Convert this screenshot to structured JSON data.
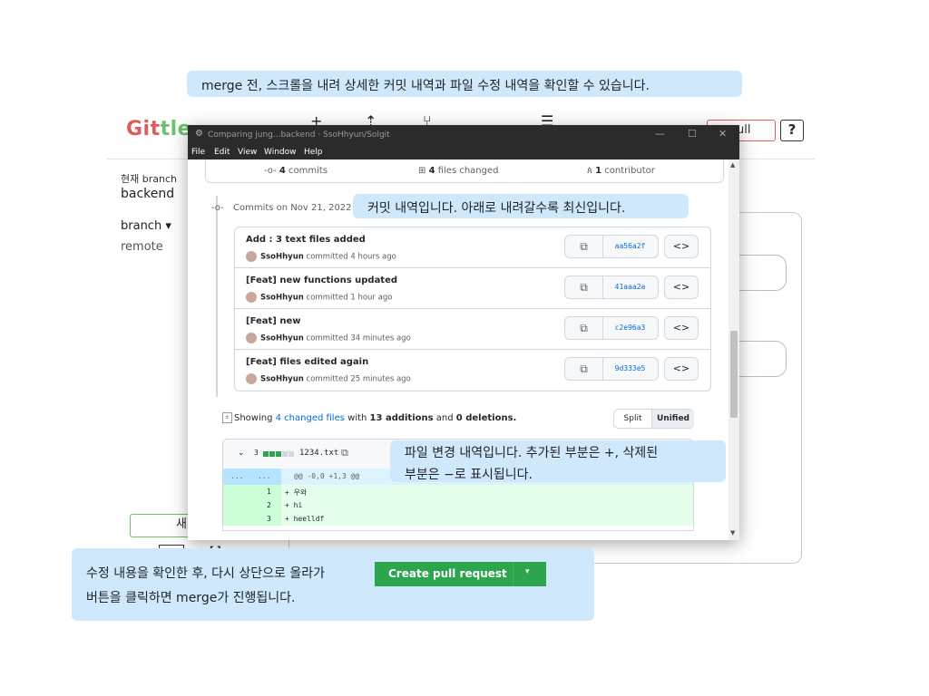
{
  "tips": {
    "top": "merge 전, 스크롤을 내려 상세한 커밋 내역과 파일 수정 내역을 확인할 수 있습니다.",
    "commits": "커밋 내역입니다. 아래로 내려갈수록 최신입니다.",
    "diff_line1": "파일 변경 내역입니다. 추가된 부분은 +, 삭제된",
    "diff_line2": "부분은 −로 표시됩니다.",
    "bottom_line1": "수정 내용을 확인한 후, 다시 상단으로 올라가",
    "bottom_line2": "버튼을 클릭하면 merge가 진행됩니다."
  },
  "app": {
    "logo_part1": "Git",
    "logo_part2": "tle",
    "pull_label": "ull",
    "help_label": "?",
    "current_branch_label": "현재 branch",
    "current_branch": "backend",
    "branch_dropdown": "branch ▾",
    "remote_label": "remote",
    "new_button_fragment": "새",
    "bottom_fragment": "[ ]"
  },
  "window": {
    "title": "Comparing jung...backend · SsoHhyun/Solgit",
    "controls": [
      "—",
      "☐",
      "✕"
    ],
    "menu": [
      "File",
      "Edit",
      "View",
      "Window",
      "Help"
    ]
  },
  "stats": {
    "commits_num": "4",
    "commits_label": "commits",
    "files_num": "4",
    "files_label": "files changed",
    "contrib_num": "1",
    "contrib_label": "contributor"
  },
  "commits_on": "Commits on Nov 21, 2022",
  "commits": [
    {
      "title": "Add : 3 text files added",
      "author": "SsoHhyun",
      "time": "committed 4 hours ago",
      "sha": "aa56a2f"
    },
    {
      "title": "[Feat] new functions updated",
      "author": "SsoHhyun",
      "time": "committed 1 hour ago",
      "sha": "41aaa2a"
    },
    {
      "title": "[Feat] new",
      "author": "SsoHhyun",
      "time": "committed 34 minutes ago",
      "sha": "c2e96a3"
    },
    {
      "title": "[Feat] files edited again",
      "author": "SsoHhyun",
      "time": "committed 25 minutes ago",
      "sha": "9d333e5"
    }
  ],
  "showing": {
    "prefix": "Showing",
    "link": "4 changed files",
    "mid": "with",
    "additions": "13 additions",
    "and": "and",
    "deletions": "0 deletions."
  },
  "view_toggle": {
    "split": "Split",
    "unified": "Unified"
  },
  "file": {
    "count": "3",
    "name": "1234.txt",
    "hunk_left": "...",
    "hunk_right": "...",
    "hunk_header": "@@ -0,0 +1,3 @@",
    "lines": [
      {
        "num": "1",
        "code": "+ 우와"
      },
      {
        "num": "2",
        "code": "+ hi"
      },
      {
        "num": "3",
        "code": "+ heelldf"
      }
    ]
  },
  "create_pr": {
    "label": "Create pull request",
    "arrow": "▾"
  },
  "colors": {
    "accent_green": "#2da44e",
    "tip_bg": "#cfe8fb",
    "link": "#0969da"
  }
}
